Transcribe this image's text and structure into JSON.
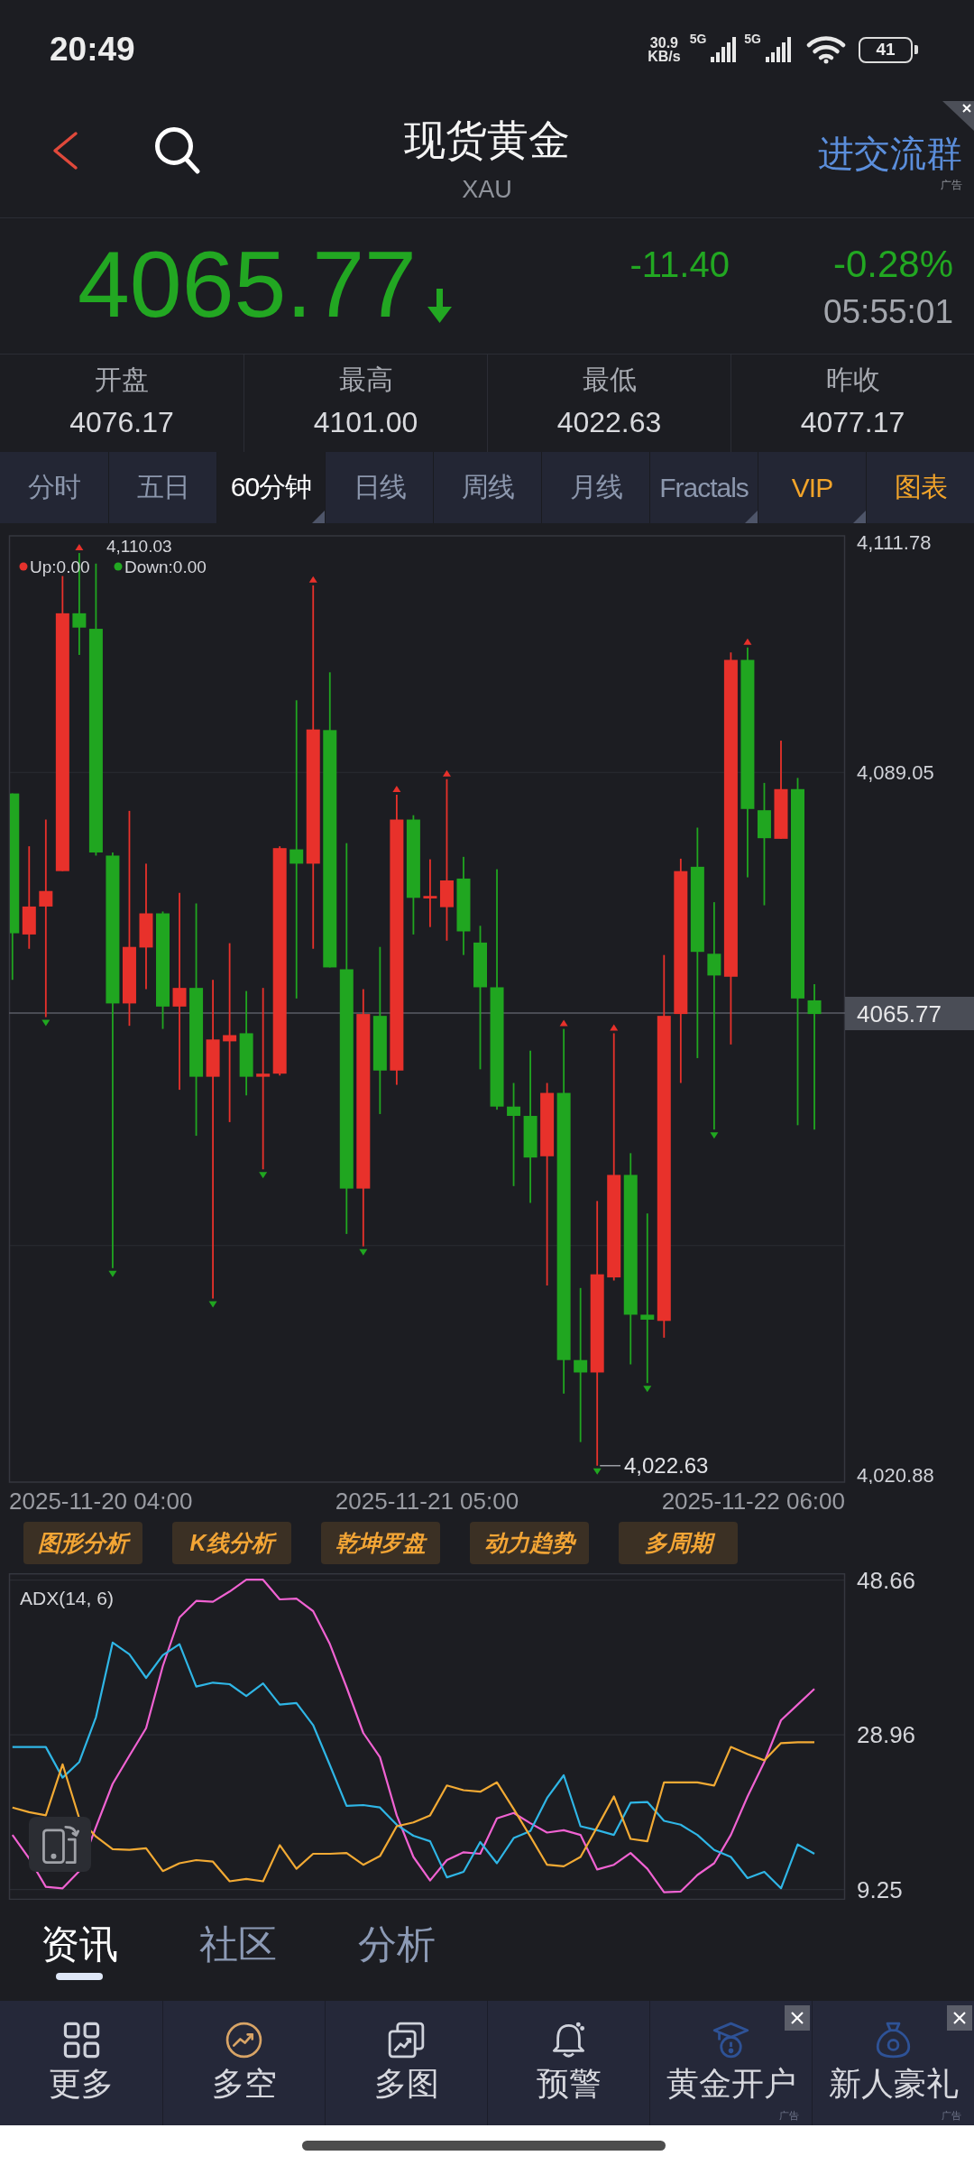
{
  "status_bar": {
    "time": "20:49",
    "net_speed": "30.9",
    "net_unit": "KB/s",
    "signals": [
      {
        "label": "5G"
      },
      {
        "label": "5G"
      }
    ],
    "battery": "41"
  },
  "header": {
    "title": "现货黄金",
    "subtitle": "XAU",
    "promo": {
      "label": "进交流群",
      "ad_label": "广告",
      "closable": true
    }
  },
  "quote": {
    "price": "4065.77",
    "down": true,
    "change": "-11.40",
    "change_percent": "-0.28%",
    "time": "05:55:01"
  },
  "stats": [
    {
      "label": "开盘",
      "value": "4076.17"
    },
    {
      "label": "最高",
      "value": "4101.00"
    },
    {
      "label": "最低",
      "value": "4022.63"
    },
    {
      "label": "昨收",
      "value": "4077.17"
    }
  ],
  "period_tabs": [
    {
      "label": "分时",
      "selected": false,
      "dropdown": false,
      "accent": false
    },
    {
      "label": "五日",
      "selected": false,
      "dropdown": false,
      "accent": false
    },
    {
      "label": "60分钟",
      "selected": true,
      "dropdown": true,
      "accent": false
    },
    {
      "label": "日线",
      "selected": false,
      "dropdown": false,
      "accent": false
    },
    {
      "label": "周线",
      "selected": false,
      "dropdown": false,
      "accent": false
    },
    {
      "label": "月线",
      "selected": false,
      "dropdown": false,
      "accent": false
    },
    {
      "label": "Fractals",
      "selected": false,
      "dropdown": true,
      "accent": false
    },
    {
      "label": "VIP",
      "selected": false,
      "dropdown": true,
      "accent": true
    },
    {
      "label": "图表",
      "selected": false,
      "dropdown": false,
      "accent": true
    }
  ],
  "price_chart": {
    "legend": [
      {
        "label": "Up:0.00",
        "color": "#e5322d"
      },
      {
        "label": "Down:0.00",
        "color": "#22a722"
      }
    ],
    "high_label": "4,110.03",
    "low_label": "4,022.63",
    "y_labels": [
      "4,111.78",
      "4,089.05",
      "4,020.88"
    ],
    "current_price": "4065.77",
    "x_labels": [
      "2025-11-20 04:00",
      "2025-11-21 05:00",
      "2025-11-22 06:00"
    ]
  },
  "analysis_buttons": [
    {
      "label": "图形分析"
    },
    {
      "label": "K线分析"
    },
    {
      "label": "乾坤罗盘"
    },
    {
      "label": "动力趋势"
    },
    {
      "label": "多周期"
    }
  ],
  "adx_chart": {
    "chart_data": {
      "type": "line",
      "title": "ADX(14, 6)",
      "ylim": [
        8,
        49.45
      ],
      "yticks": [
        48.66,
        28.96,
        9.25
      ],
      "grid": true,
      "series": [
        {
          "color": "#f062d2",
          "values": [
            16.2,
            13.2,
            9.6,
            9.4,
            11.6,
            17.2,
            22.7,
            26.3,
            29.8,
            37.7,
            43.9,
            46.0,
            45.9,
            47.2,
            48.7,
            48.7,
            46.2,
            46.3,
            44.7,
            40.5,
            35.0,
            29.2,
            26.1,
            18.7,
            13.4,
            10.4,
            13.0,
            14.0,
            13.8,
            18.3,
            19.0,
            17.7,
            16.5,
            16.8,
            16.2,
            11.8,
            12.4,
            13.9,
            11.9,
            8.9,
            9.0,
            11.1,
            12.6,
            16.2,
            21.1,
            25.5,
            30.8,
            32.8,
            34.8
          ]
        },
        {
          "color": "#2fb6e6",
          "values": [
            27.4,
            27.4,
            27.4,
            23.5,
            25.5,
            31.2,
            40.7,
            39.2,
            36.2,
            39.1,
            40.5,
            35.1,
            35.6,
            35.4,
            33.9,
            35.5,
            32.8,
            33.0,
            30.2,
            25.1,
            19.9,
            20.0,
            19.7,
            17.5,
            16.1,
            15.4,
            10.8,
            11.5,
            15.3,
            12.6,
            15.8,
            16.7,
            20.9,
            23.8,
            17.3,
            16.8,
            16.2,
            20.3,
            20.4,
            18.0,
            17.5,
            16.2,
            14.3,
            13.4,
            10.7,
            11.5,
            9.4,
            15.0,
            13.8
          ]
        },
        {
          "color": "#f2aa34",
          "values": [
            19.7,
            19.1,
            18.7,
            25.2,
            18.3,
            16.0,
            14.4,
            14.3,
            14.5,
            11.6,
            12.6,
            13.0,
            12.8,
            10.3,
            10.6,
            10.3,
            14.9,
            11.9,
            13.8,
            13.8,
            13.9,
            12.4,
            13.5,
            17.3,
            17.8,
            18.7,
            22.5,
            21.9,
            21.7,
            22.9,
            19.5,
            16.0,
            12.4,
            12.2,
            13.4,
            17.2,
            21.1,
            15.7,
            15.4,
            22.9,
            22.9,
            22.9,
            22.5,
            27.4,
            26.5,
            25.7,
            27.9,
            28.0,
            28.0
          ]
        }
      ]
    }
  },
  "content_tabs": [
    {
      "label": "资讯",
      "selected": true
    },
    {
      "label": "社区",
      "selected": false
    },
    {
      "label": "分析",
      "selected": false
    }
  ],
  "bottom_nav": [
    {
      "kind": "grid",
      "label": "更多",
      "closable": false
    },
    {
      "kind": "trend",
      "label": "多空",
      "closable": false
    },
    {
      "kind": "charts",
      "label": "多图",
      "closable": false
    },
    {
      "kind": "bell",
      "label": "预警",
      "closable": false
    },
    {
      "kind": "account",
      "label": "黄金开户",
      "ad_label": "广告",
      "closable": true
    },
    {
      "kind": "gift",
      "label": "新人豪礼",
      "ad_label": "广告",
      "closable": true
    }
  ]
}
